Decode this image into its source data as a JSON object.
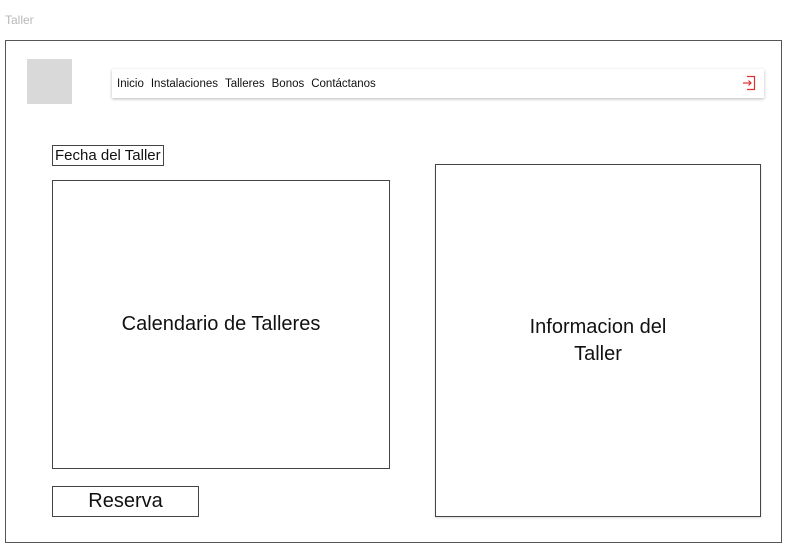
{
  "window": {
    "title": "Taller"
  },
  "header": {
    "logo": "logo-placeholder",
    "nav": [
      "Inicio",
      "Instalaciones",
      "Talleres",
      "Bonos",
      "Contáctanos"
    ],
    "logout_icon": "logout-icon",
    "logout_color": "#e03030"
  },
  "main": {
    "date_label": "Fecha del Taller",
    "calendar_placeholder": "Calendario de Talleres",
    "info_placeholder": "Informacion del Taller",
    "reserve_button": "Reserva"
  }
}
